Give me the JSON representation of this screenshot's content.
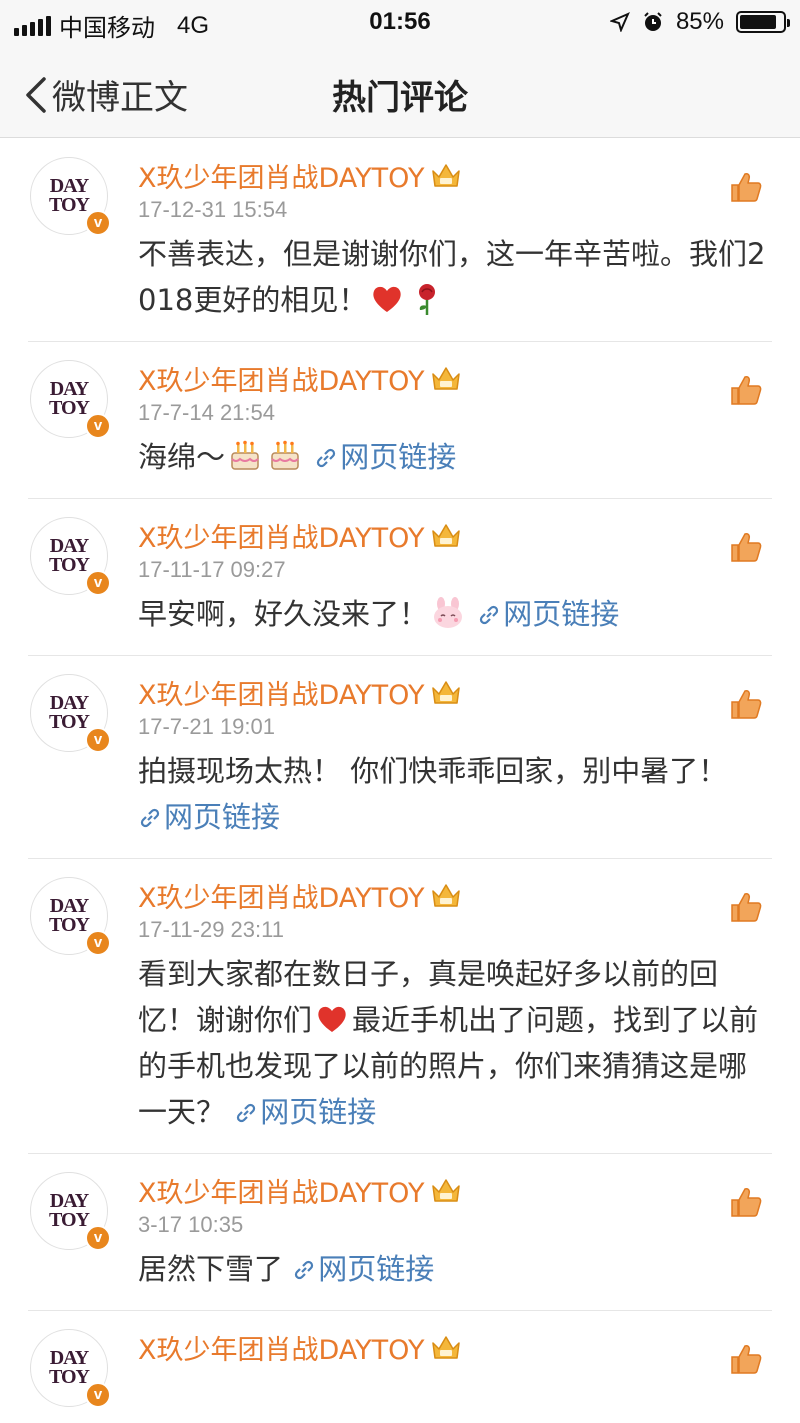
{
  "status_bar": {
    "carrier": "中国移动",
    "network": "4G",
    "time": "01:56",
    "battery": "85%",
    "battery_level": 0.85
  },
  "nav": {
    "back_label": "微博正文",
    "title": "热门评论"
  },
  "colors": {
    "name": "#e87a2c",
    "link": "#4a7fb8",
    "time": "#9a9a9a",
    "badge": "#e8861d"
  },
  "comments": [
    {
      "author": "X玖少年团肖战DAYTOY",
      "time": "17-12-31 15:54",
      "text": "不善表达，但是谢谢你们，这一年辛苦啦。我们2018更好的相见！",
      "emojis": [
        "heart-emoji",
        "rose-emoji"
      ],
      "link": ""
    },
    {
      "author": "X玖少年团肖战DAYTOY",
      "time": "17-7-14 21:54",
      "text": "海绵～",
      "emojis": [
        "cake-emoji",
        "cake-emoji"
      ],
      "link": "网页链接"
    },
    {
      "author": "X玖少年团肖战DAYTOY",
      "time": "17-11-17 09:27",
      "text": "早安啊，好久没来了！",
      "emojis": [
        "bunny-emoji"
      ],
      "link": "网页链接"
    },
    {
      "author": "X玖少年团肖战DAYTOY",
      "time": "17-7-21 19:01",
      "text": "拍摄现场太热！ 你们快乖乖回家，别中暑了！",
      "emojis": [],
      "link": "网页链接"
    },
    {
      "author": "X玖少年团肖战DAYTOY",
      "time": "17-11-29 23:11",
      "text": "看到大家都在数日子，真是唤起好多以前的回忆！谢谢你们",
      "emojis": [
        "heart-emoji"
      ],
      "text2": "最近手机出了问题，找到了以前的手机也发现了以前的照片，你们来猜猜这是哪一天？",
      "link": "网页链接"
    },
    {
      "author": "X玖少年团肖战DAYTOY",
      "time": "3-17 10:35",
      "text": "居然下雪了",
      "emojis": [],
      "link": "网页链接"
    },
    {
      "author": "X玖少年团肖战DAYTOY",
      "time": "",
      "text": "",
      "emojis": [],
      "link": ""
    }
  ],
  "avatar_logo": "DAY TOY",
  "icons": {
    "back": "chevron-left-icon",
    "like": "thumbs-up-icon",
    "crown": "crown-icon",
    "verified": "verified-v-badge-icon",
    "link": "link-icon"
  }
}
